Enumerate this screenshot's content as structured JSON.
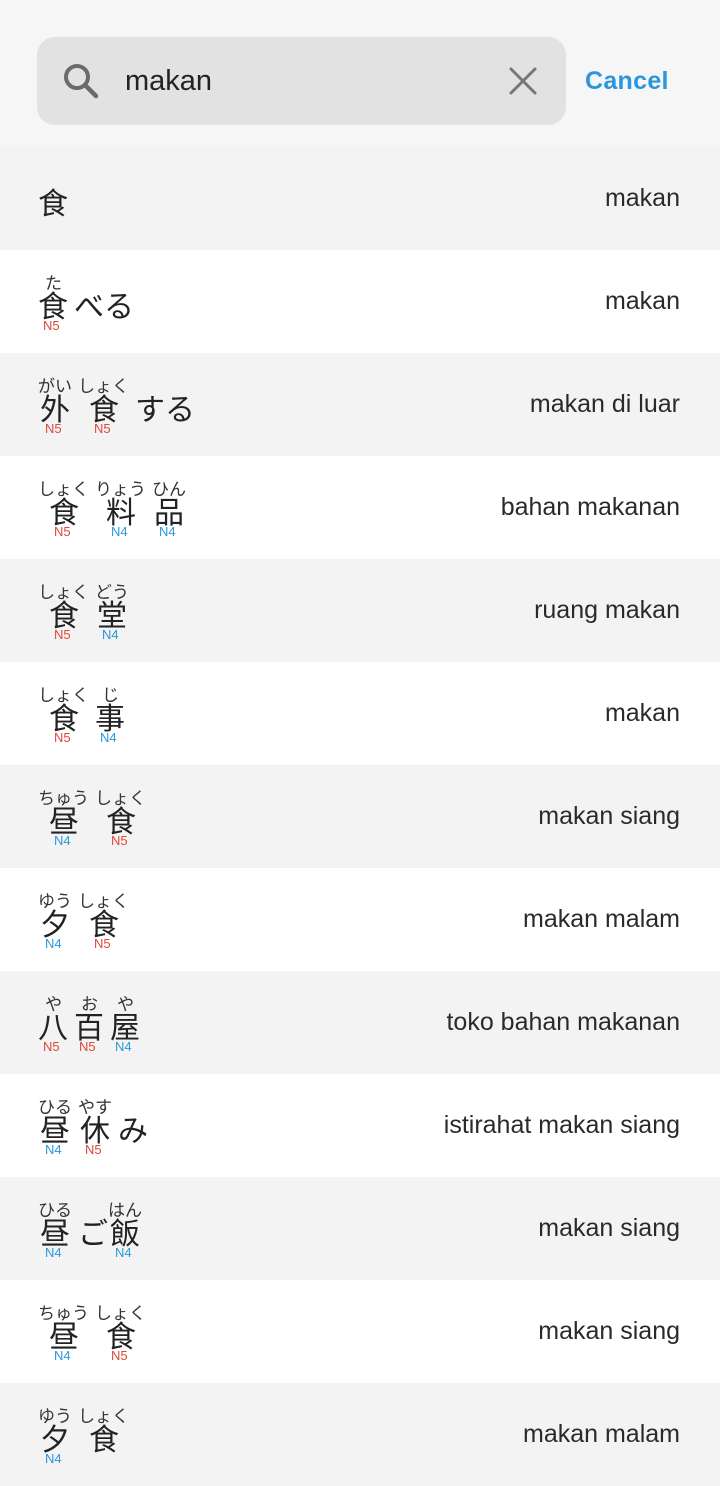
{
  "search": {
    "query": "makan",
    "cancel_label": "Cancel"
  },
  "colors": {
    "accent": "#2a97dc",
    "n5": "#e0473c",
    "n4": "#2a97dc"
  },
  "results": [
    {
      "meaning": "makan",
      "segments": [
        {
          "kanji": "食",
          "furigana": "",
          "tags": []
        }
      ]
    },
    {
      "meaning": "makan",
      "segments": [
        {
          "kanji": "食",
          "furigana": "た",
          "tags": [
            "N5"
          ]
        },
        {
          "kanji": "べる",
          "furigana": "",
          "tags": []
        }
      ]
    },
    {
      "meaning": "makan di luar",
      "segments": [
        {
          "kanji": "外",
          "furigana": "がい",
          "tags": [
            "N5"
          ]
        },
        {
          "kanji": "食",
          "furigana": "しょく",
          "tags": [
            "N5"
          ]
        },
        {
          "kanji": "する",
          "furigana": "",
          "tags": []
        }
      ]
    },
    {
      "meaning": "bahan makanan",
      "segments": [
        {
          "kanji": "食",
          "furigana": "しょく",
          "tags": [
            "N5"
          ]
        },
        {
          "kanji": "料",
          "furigana": "りょう",
          "tags": [
            "N4"
          ]
        },
        {
          "kanji": "品",
          "furigana": "ひん",
          "tags": [
            "N4"
          ]
        }
      ]
    },
    {
      "meaning": "ruang makan",
      "segments": [
        {
          "kanji": "食",
          "furigana": "しょく",
          "tags": [
            "N5"
          ]
        },
        {
          "kanji": "堂",
          "furigana": "どう",
          "tags": [
            "N4"
          ]
        }
      ]
    },
    {
      "meaning": "makan",
      "segments": [
        {
          "kanji": "食",
          "furigana": "しょく",
          "tags": [
            "N5"
          ]
        },
        {
          "kanji": "事",
          "furigana": "じ",
          "tags": [
            "N4"
          ]
        }
      ]
    },
    {
      "meaning": "makan siang",
      "segments": [
        {
          "kanji": "昼",
          "furigana": "ちゅう",
          "tags": [
            "N4"
          ]
        },
        {
          "kanji": "食",
          "furigana": "しょく",
          "tags": [
            "N5"
          ]
        }
      ]
    },
    {
      "meaning": "makan malam",
      "segments": [
        {
          "kanji": "夕",
          "furigana": "ゆう",
          "tags": [
            "N4"
          ]
        },
        {
          "kanji": "食",
          "furigana": "しょく",
          "tags": [
            "N5"
          ]
        }
      ]
    },
    {
      "meaning": "toko bahan makanan",
      "segments": [
        {
          "kanji": "八",
          "furigana": "や",
          "tags": [
            "N5"
          ]
        },
        {
          "kanji": "百",
          "furigana": "お",
          "tags": [
            "N5"
          ]
        },
        {
          "kanji": "屋",
          "furigana": "や",
          "tags": [
            "N4"
          ]
        }
      ]
    },
    {
      "meaning": "istirahat makan siang",
      "segments": [
        {
          "kanji": "昼",
          "furigana": "ひる",
          "tags": [
            "N4"
          ]
        },
        {
          "kanji": "休",
          "furigana": "やす",
          "tags": [
            "N5"
          ]
        },
        {
          "kanji": "み",
          "furigana": "",
          "tags": []
        }
      ]
    },
    {
      "meaning": "makan siang",
      "segments": [
        {
          "kanji": "昼",
          "furigana": "ひる",
          "tags": [
            "N4"
          ]
        },
        {
          "kanji": "ご",
          "furigana": "",
          "tags": []
        },
        {
          "kanji": "飯",
          "furigana": "はん",
          "tags": [
            "N4"
          ]
        }
      ]
    },
    {
      "meaning": "makan siang",
      "segments": [
        {
          "kanji": "昼",
          "furigana": "ちゅう",
          "tags": [
            "N4"
          ]
        },
        {
          "kanji": "食",
          "furigana": "しょく",
          "tags": [
            "N5"
          ]
        }
      ]
    },
    {
      "meaning": "makan malam",
      "segments": [
        {
          "kanji": "夕",
          "furigana": "ゆう",
          "tags": [
            "N4"
          ]
        },
        {
          "kanji": "食",
          "furigana": "しょく",
          "tags": []
        }
      ]
    }
  ]
}
